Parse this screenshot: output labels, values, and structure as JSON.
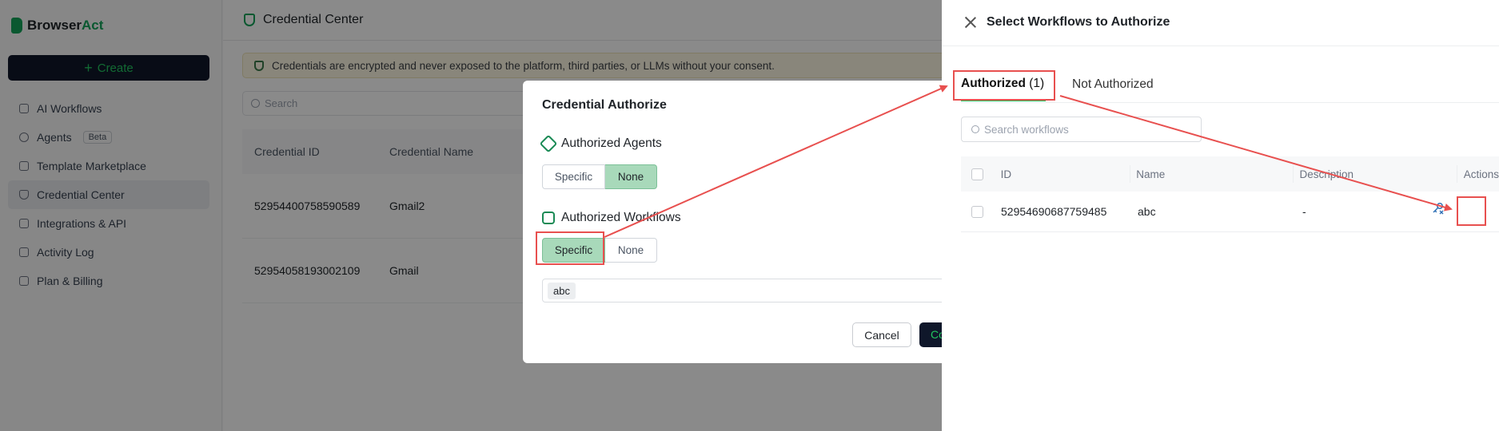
{
  "sidebar": {
    "brand_a": "Browser",
    "brand_b": "Act",
    "create_label": "Create",
    "items": [
      {
        "label": "AI Workflows"
      },
      {
        "label": "Agents",
        "badge": "Beta"
      },
      {
        "label": "Template Marketplace"
      },
      {
        "label": "Credential Center",
        "active": true
      },
      {
        "label": "Integrations & API"
      },
      {
        "label": "Activity Log"
      },
      {
        "label": "Plan & Billing"
      }
    ]
  },
  "main": {
    "page_title": "Credential Center",
    "banner_text": "Credentials are encrypted and never exposed to the platform, third parties, or LLMs without your consent.",
    "search_placeholder": "Search",
    "columns": [
      "Credential ID",
      "Credential Name"
    ],
    "rows": [
      {
        "id": "52954400758590589",
        "name": "Gmail2"
      },
      {
        "id": "52954058193002109",
        "name": "Gmail"
      }
    ]
  },
  "modal": {
    "title": "Credential Authorize",
    "agents_label": "Authorized Agents",
    "agents_options": [
      "Specific",
      "None"
    ],
    "agents_selected": "None",
    "workflows_label": "Authorized Workflows",
    "workflows_options": [
      "Specific",
      "None"
    ],
    "workflows_selected": "Specific",
    "selected_tag": "abc",
    "cancel_label": "Cancel",
    "confirm_label": "Co"
  },
  "drawer": {
    "title": "Select Workflows to Authorize",
    "tab_authorized": "Authorized",
    "tab_authorized_count": "(1)",
    "tab_not_authorized": "Not Authorized",
    "search_placeholder": "Search workflows",
    "columns": {
      "id": "ID",
      "name": "Name",
      "description": "Description",
      "actions": "Actions"
    },
    "rows": [
      {
        "id": "52954690687759485",
        "name": "abc",
        "description": "-"
      }
    ]
  },
  "colors": {
    "accent_green": "#22c55e",
    "annotation_red": "#e8504f",
    "dark_button": "#0f172a"
  },
  "icons": [
    "logo-icon",
    "plus-icon",
    "shield-icon",
    "search-icon",
    "close-icon",
    "agent-icon",
    "workflow-icon",
    "unauthorize-icon"
  ]
}
